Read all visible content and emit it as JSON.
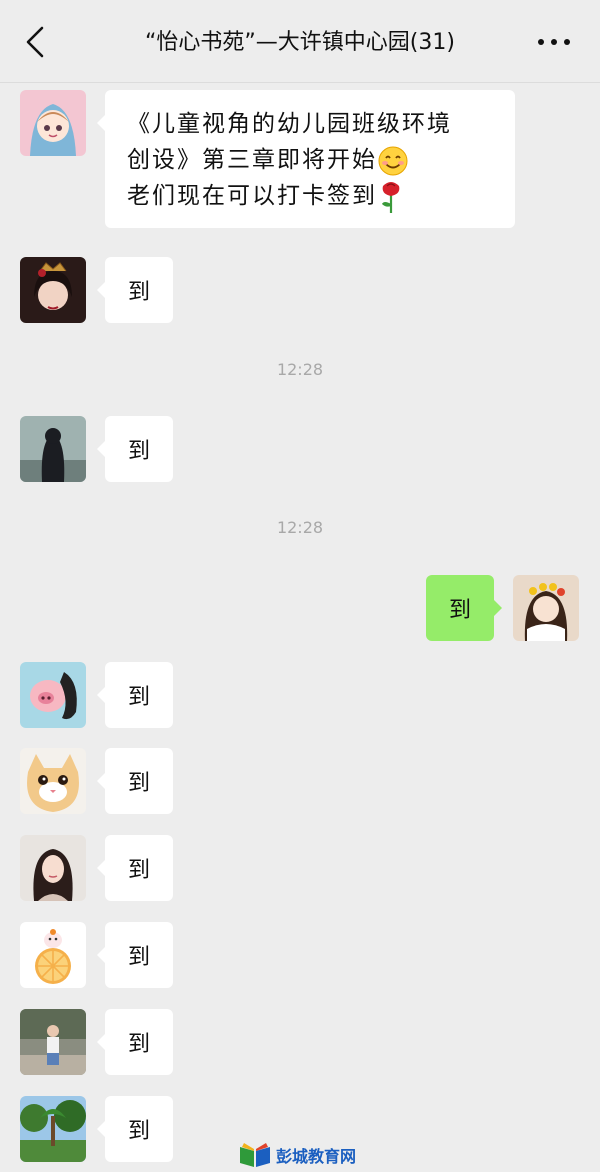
{
  "header": {
    "title": "“怡心书苑”—大许镇中心园(31)",
    "back_icon": "chevron-left-icon",
    "more_icon": "more-dots-icon"
  },
  "messages": [
    {
      "type": "text",
      "side": "left",
      "lines": [
        "《儿童视角的幼儿园班级环境",
        "创设》第三章即将开始",
        "老们现在可以打卡签到"
      ],
      "emojis": [
        "smile-emoji",
        "rose-emoji"
      ]
    },
    {
      "type": "text",
      "side": "left",
      "text": "到"
    },
    {
      "type": "time",
      "text": "12:28"
    },
    {
      "type": "text",
      "side": "left",
      "text": "到"
    },
    {
      "type": "time",
      "text": "12:28"
    },
    {
      "type": "text",
      "side": "right",
      "text": "到"
    },
    {
      "type": "text",
      "side": "left",
      "text": "到"
    },
    {
      "type": "text",
      "side": "left",
      "text": "到"
    },
    {
      "type": "text",
      "side": "left",
      "text": "到"
    },
    {
      "type": "text",
      "side": "left",
      "text": "到"
    },
    {
      "type": "text",
      "side": "left",
      "text": "到"
    },
    {
      "type": "text",
      "side": "left",
      "text": "到"
    }
  ],
  "watermark": {
    "text": "彭城教育网"
  },
  "colors": {
    "background": "#ededed",
    "my_bubble": "#95ec69",
    "other_bubble": "#ffffff"
  }
}
